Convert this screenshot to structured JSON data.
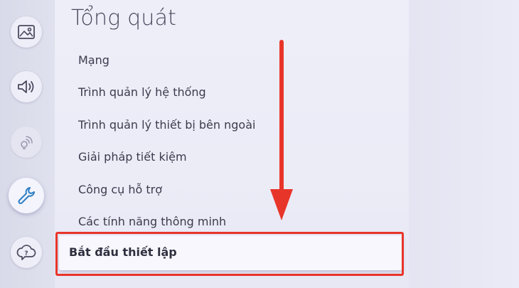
{
  "header": {
    "title": "Tổng quát"
  },
  "sidebar": {
    "icons": [
      {
        "icon": "picture-icon"
      },
      {
        "icon": "sound-icon"
      },
      {
        "icon": "broadcast-icon"
      },
      {
        "icon": "wrench-icon",
        "active": true
      },
      {
        "icon": "support-icon"
      }
    ]
  },
  "menu": {
    "items": [
      {
        "label": "Mạng"
      },
      {
        "label": "Trình quản lý hệ thống"
      },
      {
        "label": "Trình quản lý thiết bị bên ngoài"
      },
      {
        "label": "Giải pháp tiết kiệm"
      },
      {
        "label": "Công cụ hỗ trợ"
      },
      {
        "label": "Các tính năng thông minh"
      }
    ],
    "selected": {
      "label": "Bắt đầu thiết lập"
    }
  },
  "annotation": {
    "color": "#e8352a"
  }
}
